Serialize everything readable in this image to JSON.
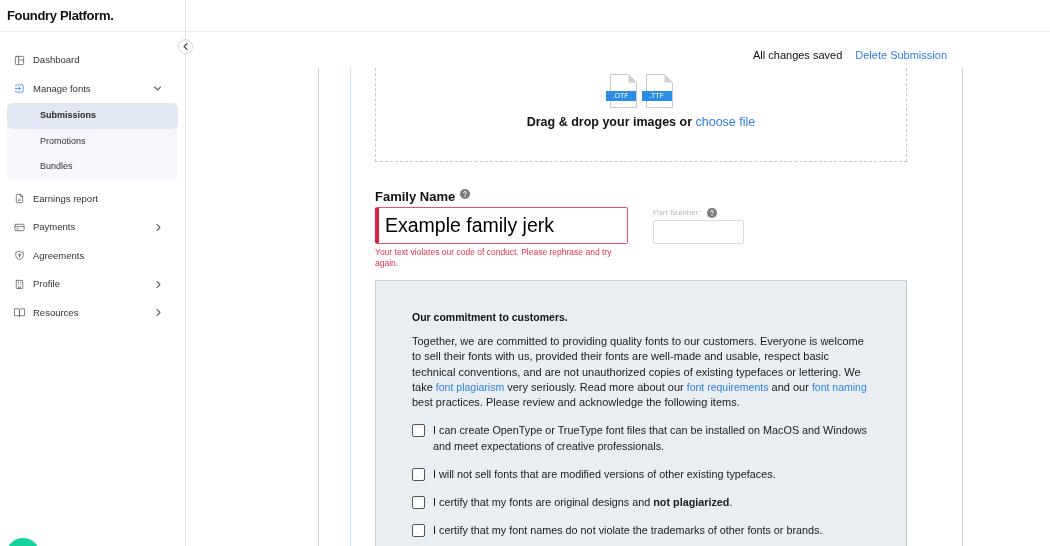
{
  "app": {
    "logo": "Foundry Platform."
  },
  "sidebar": {
    "items": [
      {
        "label": "Dashboard",
        "selected": false
      },
      {
        "label": "Manage fonts",
        "selected": true,
        "expanded": true,
        "children": [
          {
            "label": "Submissions",
            "selected": true
          },
          {
            "label": "Promotions",
            "selected": false
          },
          {
            "label": "Bundles",
            "selected": false
          }
        ]
      },
      {
        "label": "Earnings report",
        "selected": false
      },
      {
        "label": "Payments",
        "selected": false,
        "expanded": false
      },
      {
        "label": "Agreements",
        "selected": false
      },
      {
        "label": "Profile",
        "selected": false,
        "expanded": false
      },
      {
        "label": "Resources",
        "selected": false,
        "expanded": false
      }
    ]
  },
  "top_bar": {
    "status": "All changes saved",
    "action": "Delete Submission"
  },
  "upload": {
    "file_types": [
      ".OTF",
      ".TTF"
    ],
    "prompt": "Drag & drop your images or",
    "link": "choose file"
  },
  "family_name": {
    "label": "Family Name",
    "value": "Example family jerk",
    "error": "Your text violates our code of conduct. Please rephrase and try again."
  },
  "part_number": {
    "label": "Part Number:"
  },
  "commitment": {
    "title": "Our commitment to customers.",
    "body": [
      {
        "kind": "text",
        "text": "Together, we are committed to providing quality fonts to our customers. Everyone is welcome to sell their fonts with us, provided their fonts are well-made and usable, respect basic technical conventions, and are not unauthorized copies of existing typefaces or lettering. We take "
      },
      {
        "kind": "link",
        "text": "font plagiarism"
      },
      {
        "kind": "text",
        "text": " very seriously. Read more about our "
      },
      {
        "kind": "link",
        "text": "font requirements"
      },
      {
        "kind": "text",
        "text": " and our "
      },
      {
        "kind": "link",
        "text": "font naming"
      },
      {
        "kind": "text",
        "text": " best practices. Please review and acknowledge the following items."
      }
    ],
    "items": [
      {
        "text": "I can create OpenType or TrueType font files that can be installed on MacOS and Windows and meet expectations of creative professionals.",
        "checked": false
      },
      {
        "text": "I will not sell fonts that are modified versions of other existing typefaces.",
        "checked": false
      },
      {
        "text": "I certify that my fonts are original designs and **not plagiarized**.",
        "checked": false
      },
      {
        "text": "I certify that my font names do not violate the trademarks of other fonts or brands.",
        "checked": false
      }
    ]
  }
}
